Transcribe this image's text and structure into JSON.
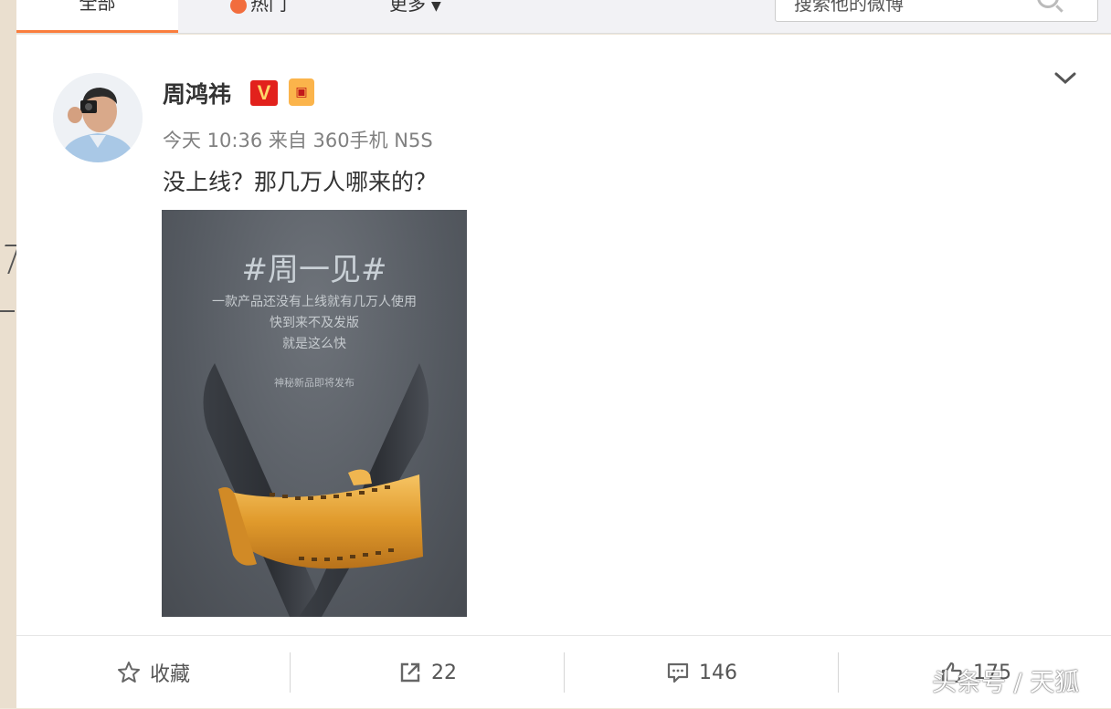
{
  "tabs": {
    "all_label": "全部",
    "hot_label": "热门",
    "more_label": "更多"
  },
  "search": {
    "placeholder": "搜索他的微博"
  },
  "post": {
    "username": "周鸿祎",
    "verified_badge": "V",
    "meta": "今天 10:36 来自 360手机 N5S",
    "text": "没上线？那几万人哪来的？",
    "image": {
      "title": "#周一见#",
      "line1": "一款产品还没有上线就有几万人使用",
      "line2": "快到来不及发版",
      "line3": "就是这么快",
      "small": "神秘新品即将发布"
    }
  },
  "actions": {
    "favorite_label": "收藏",
    "repost_count": "22",
    "comment_count": "146",
    "like_count": "175"
  },
  "watermark": "头条号 / 天狐",
  "colors": {
    "accent": "#fa7d3c",
    "verified": "#e2211c",
    "film": "#e0a236"
  }
}
